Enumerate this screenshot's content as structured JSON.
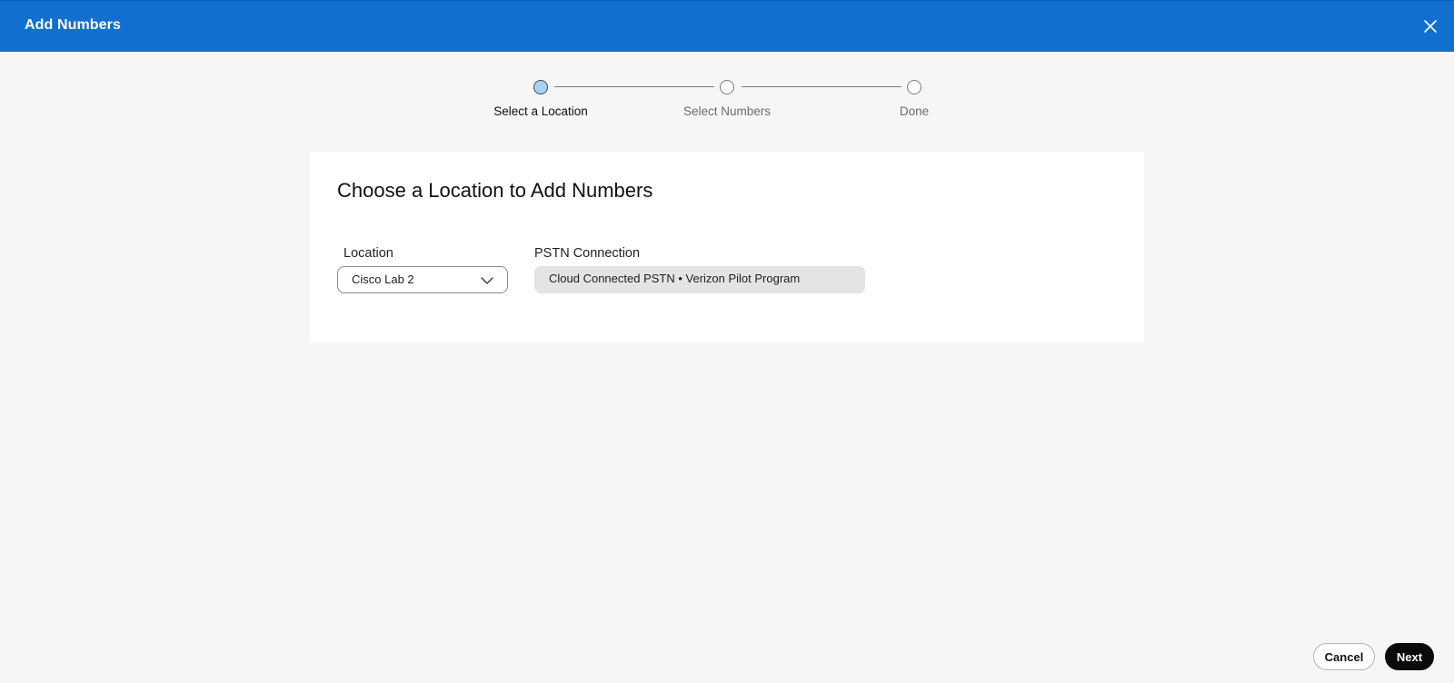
{
  "header": {
    "title": "Add Numbers",
    "close_icon": "close-icon",
    "background": "#1170cf"
  },
  "stepper": {
    "steps": [
      {
        "label": "Select a Location",
        "state": "active"
      },
      {
        "label": "Select Numbers",
        "state": "pending"
      },
      {
        "label": "Done",
        "state": "pending"
      }
    ]
  },
  "card": {
    "title": "Choose a Location to Add Numbers",
    "location": {
      "label": "Location",
      "value": "Cisco Lab 2",
      "icon": "chevron-down-icon"
    },
    "pstn": {
      "label": "PSTN Connection",
      "value": "Cloud Connected PSTN • Verizon Pilot Program"
    }
  },
  "footer": {
    "cancel_label": "Cancel",
    "next_label": "Next"
  }
}
